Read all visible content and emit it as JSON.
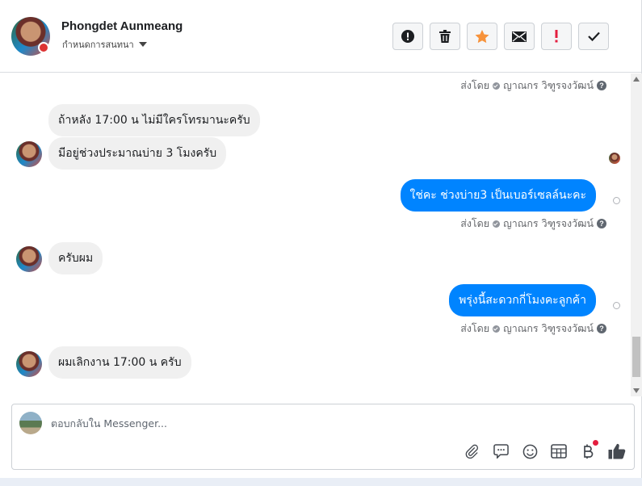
{
  "header": {
    "contact_name": "Phongdet Aunmeang",
    "subtitle": "กำหนดการสนทนา",
    "actions": [
      "report",
      "delete",
      "star",
      "mail",
      "important",
      "done"
    ]
  },
  "thread": {
    "sent_by_label": "ส่งโดย",
    "sender_name": "ญาณกร วิฑูรจงวัฒน์",
    "messages": [
      {
        "dir": "in",
        "text": "ถ้าหลัง 17:00 น ไม่มีใครโทรมานะครับ"
      },
      {
        "dir": "in",
        "text": "มีอยู่ช่วงประมาณบ่าย 3 โมงครับ"
      },
      {
        "dir": "out",
        "text": "ใช่คะ ช่วงบ่าย3 เป็นเบอร์เซลล์นะคะ"
      },
      {
        "dir": "in",
        "text": "ครับผม"
      },
      {
        "dir": "out",
        "text": "พรุ่งนี้สะดวกกี่โมงคะลูกค้า"
      },
      {
        "dir": "in",
        "text": "ผมเลิกงาน 17:00 น ครับ"
      }
    ]
  },
  "composer": {
    "placeholder": "ตอบกลับใน Messenger...",
    "tools": [
      "paperclip-icon",
      "speech-bubble-icon",
      "smiley-icon",
      "table-icon",
      "baht-icon",
      "thumbs-up-icon"
    ]
  },
  "colors": {
    "accent": "#0084ff",
    "incoming_bubble": "#f0f0f0",
    "star": "#f7923a",
    "important": "#e41e3f"
  }
}
